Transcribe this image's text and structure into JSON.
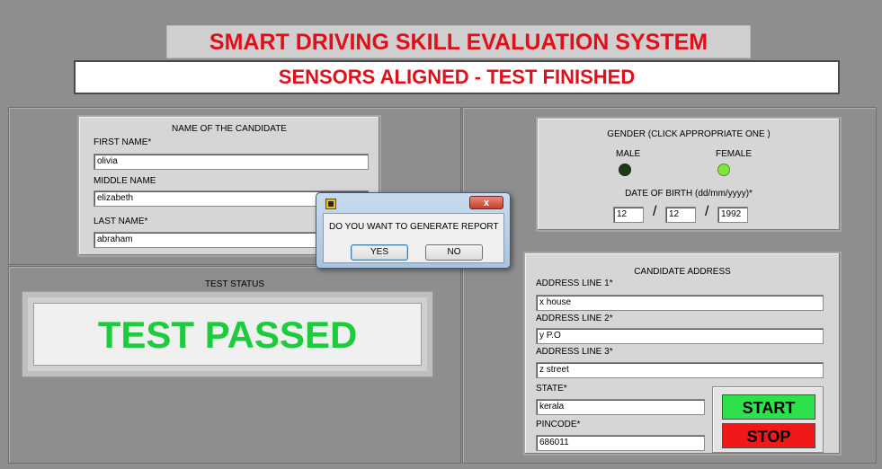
{
  "header": {
    "title": "SMART DRIVING SKILL EVALUATION SYSTEM",
    "status": "SENSORS ALIGNED - TEST FINISHED"
  },
  "candidate_name": {
    "heading": "NAME OF THE CANDIDATE",
    "first_label": "FIRST NAME*",
    "first_value": "olivia",
    "middle_label": "MIDDLE NAME",
    "middle_value": "elizabeth",
    "last_label": "LAST NAME*",
    "last_value": "abraham"
  },
  "gender": {
    "heading": "GENDER (CLICK APPROPRIATE ONE )",
    "male_label": "MALE",
    "female_label": "FEMALE",
    "selected": "female",
    "led_on_color": "#7fe63c",
    "led_off_color": "#1e3a14"
  },
  "dob": {
    "label": "DATE OF BIRTH (dd/mm/yyyy)*",
    "day": "12",
    "month": "12",
    "year": "1992",
    "separator": "/"
  },
  "test_status": {
    "heading": "TEST STATUS",
    "result": "TEST PASSED",
    "result_color": "#1dcc3c"
  },
  "address": {
    "heading": "CANDIDATE ADDRESS",
    "line1_label": "ADDRESS LINE 1*",
    "line1_value": "x house",
    "line2_label": "ADDRESS LINE 2*",
    "line2_value": "y P.O",
    "line3_label": "ADDRESS LINE 3*",
    "line3_value": "z street",
    "state_label": "STATE*",
    "state_value": "kerala",
    "pincode_label": "PINCODE*",
    "pincode_value": "686011"
  },
  "controls": {
    "start_label": "START",
    "stop_label": "STOP",
    "start_color": "#2ee04a",
    "stop_color": "#f01818"
  },
  "dialog": {
    "close_label": "x",
    "message": "DO YOU WANT TO GENERATE REPORT",
    "yes_label": "YES",
    "no_label": "NO"
  }
}
